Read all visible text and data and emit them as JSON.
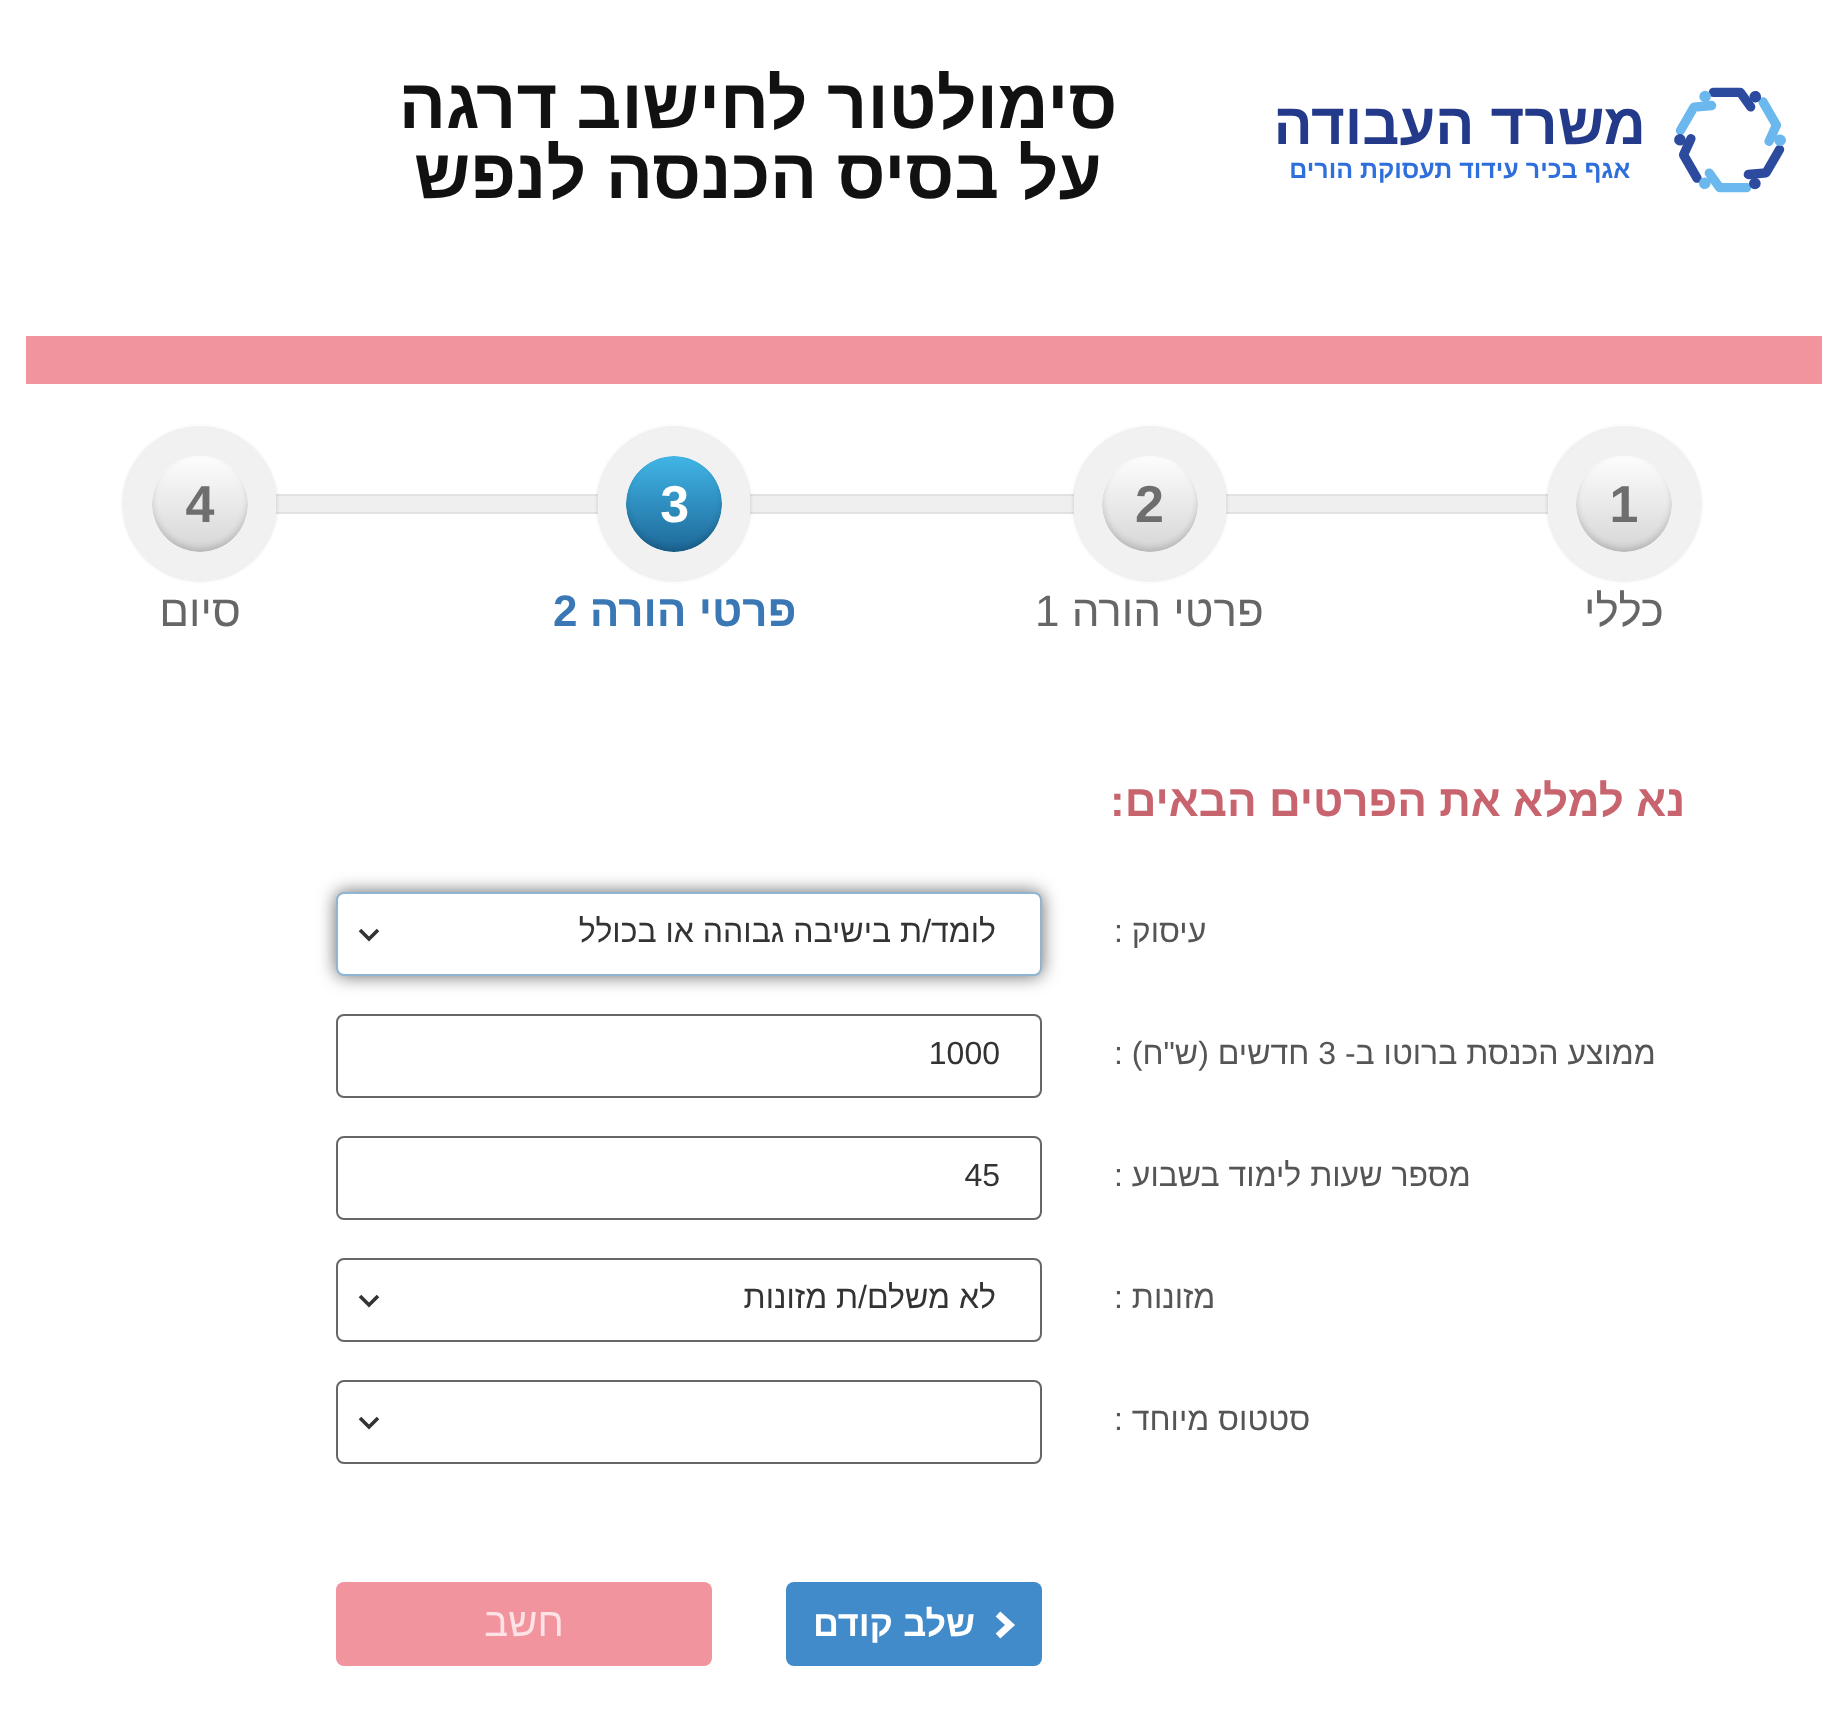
{
  "header": {
    "title_lines": [
      "סימולטור לחישוב דרגה",
      "על בסיס הכנסה לנפש"
    ],
    "logo": {
      "title": "משרד העבודה",
      "subtitle": "אגף בכיר עידוד תעסוקת הורים"
    }
  },
  "steps": [
    {
      "number": "1",
      "label": "כללי",
      "selected": false
    },
    {
      "number": "2",
      "label": "פרטי הורה 1",
      "selected": false
    },
    {
      "number": "3",
      "label": "פרטי הורה 2",
      "selected": true
    },
    {
      "number": "4",
      "label": "סיום",
      "selected": false
    }
  ],
  "form": {
    "heading": "נא למלא את הפרטים הבאים:",
    "fields": [
      {
        "kind": "select",
        "label": "עיסוק :",
        "value": "לומד/ת בישיבה גבוהה או בכולל",
        "focused": true
      },
      {
        "kind": "input",
        "label": "ממוצע הכנסת ברוטו ב- 3 חדשים (ש\"ח) :",
        "value": "1000",
        "focused": false
      },
      {
        "kind": "input",
        "label": "מספר שעות לימוד בשבוע :",
        "value": "45",
        "focused": false
      },
      {
        "kind": "select",
        "label": "מזונות :",
        "value": "לא משלם/ת מזונות",
        "focused": false
      },
      {
        "kind": "select",
        "label": "סטטוס מיוחד :",
        "focused": false
      }
    ]
  },
  "buttons": [
    {
      "kind": "back",
      "label": "שלב קודם",
      "disabled": false
    },
    {
      "kind": "calculate",
      "label": "חשב",
      "disabled": true
    }
  ]
}
